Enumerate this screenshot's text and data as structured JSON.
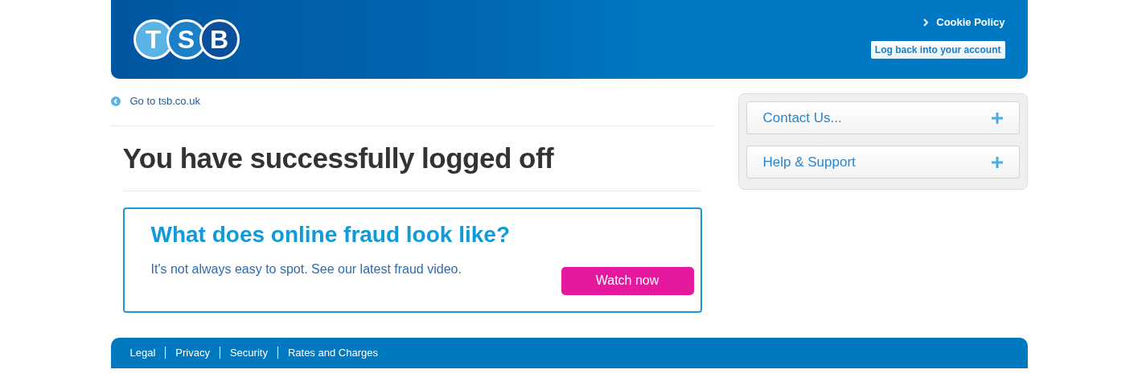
{
  "header": {
    "logo_letters": [
      "T",
      "S",
      "B"
    ],
    "cookie_link": "Cookie Policy",
    "login_button": "Log back into your account"
  },
  "back_link": "Go to tsb.co.uk",
  "heading": "You have successfully logged off",
  "promo": {
    "title": "What does online fraud look like?",
    "text": "It's not always easy to spot. See our latest fraud video.",
    "button": "Watch now"
  },
  "sidebar": {
    "items": [
      {
        "label": "Contact Us...",
        "expanded": false
      },
      {
        "label": "Help & Support",
        "expanded": false
      }
    ]
  },
  "footer": {
    "links": [
      "Legal",
      "Privacy",
      "Security",
      "Rates and Charges"
    ]
  }
}
